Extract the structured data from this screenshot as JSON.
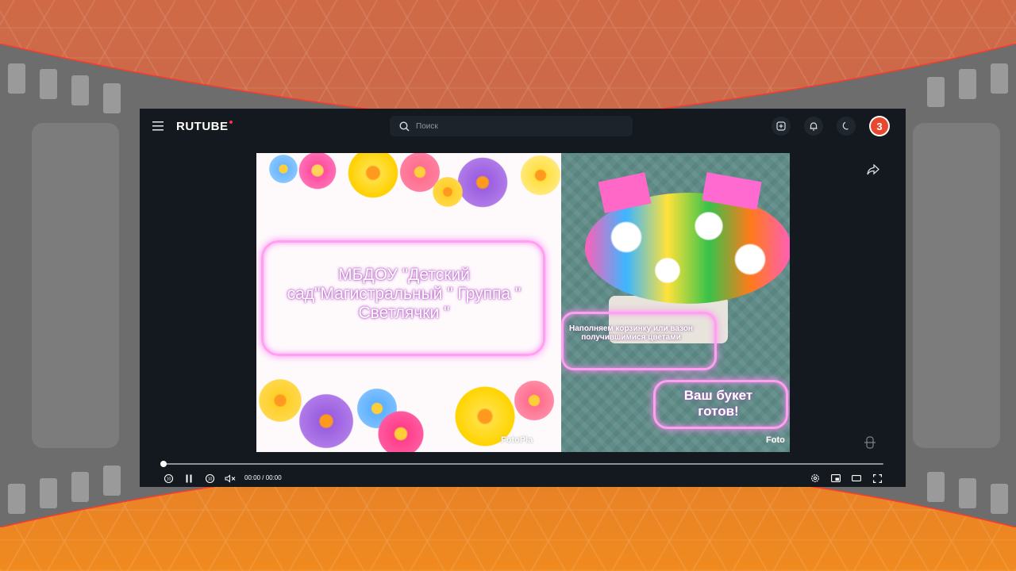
{
  "header": {
    "logo": "RUTUBE",
    "search_placeholder": "Поиск"
  },
  "video": {
    "title_overlay": "МБДОУ \"Детский сад\"Магистральный \" Группа \" Светлячки \"",
    "caption_1": "Наполняем корзинку или вазон получившимися цветами",
    "caption_2": "Ваш букет готов!",
    "watermark_1": "FotoPla",
    "watermark_2": "Foto"
  },
  "player": {
    "time": "00:00 / 00:00",
    "progress": 0
  },
  "colors": {
    "accent": "#ff2e4d",
    "app_bg": "#14191f",
    "neon": "#ff9ff2",
    "avatar": "#e8482f"
  },
  "icons": [
    "menu-icon",
    "search-icon",
    "upload-icon",
    "bell-icon",
    "moon-icon",
    "share-icon",
    "rewind-10-icon",
    "pause-icon",
    "forward-10-icon",
    "mute-icon",
    "settings-icon",
    "miniplayer-icon",
    "theater-icon",
    "fullscreen-icon",
    "drag-handle-icon"
  ]
}
